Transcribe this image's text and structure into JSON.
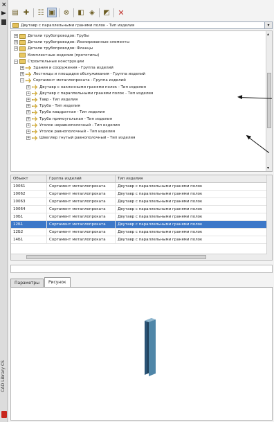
{
  "palette": {
    "title": "CAD Library CS"
  },
  "toolbar": {
    "buttons": [
      "folder-icon",
      "add-icon",
      "tree-view-icon",
      "list-view-icon",
      "binoculars-icon",
      "export-icon",
      "filter-icon",
      "properties-icon",
      "delete-icon"
    ]
  },
  "path": {
    "value": "Двутавр с параллельными гранями полок - Тип изделия"
  },
  "tree": {
    "rows": [
      {
        "label": "Детали трубопроводов: Трубы",
        "expander": "+",
        "level": 1,
        "kind": "folder"
      },
      {
        "label": "Детали трубопроводов: Изолированные элементы",
        "expander": "+",
        "level": 1,
        "kind": "folder"
      },
      {
        "label": "Детали трубопроводов: Фланцы",
        "expander": "+",
        "level": 1,
        "kind": "folder"
      },
      {
        "label": "Комплектные изделия (прототипы)",
        "expander": "",
        "level": 1,
        "kind": "folder"
      },
      {
        "label": "Строительные конструкции",
        "expander": "−",
        "level": 1,
        "kind": "folder"
      },
      {
        "label": "Здания и сооружения - Группа изделий",
        "expander": "+",
        "level": 2,
        "kind": "item"
      },
      {
        "label": "Лестницы и площадки обслуживания - Группа изделий",
        "expander": "+",
        "level": 2,
        "kind": "item"
      },
      {
        "label": "Сортамент металлопроката - Группа изделий",
        "expander": "−",
        "level": 2,
        "kind": "item"
      },
      {
        "label": "Двутавр с наклонными гранями полок - Тип изделия",
        "expander": "+",
        "level": 3,
        "kind": "item"
      },
      {
        "label": "Двутавр с параллельными гранями полок - Тип изделия",
        "expander": "+",
        "level": 3,
        "kind": "item"
      },
      {
        "label": "Тавр - Тип изделия",
        "expander": "+",
        "level": 3,
        "kind": "item"
      },
      {
        "label": "Труба - Тип изделия",
        "expander": "+",
        "level": 3,
        "kind": "item"
      },
      {
        "label": "Труба квадратная - Тип изделия",
        "expander": "+",
        "level": 3,
        "kind": "item"
      },
      {
        "label": "Труба прямоугольная - Тип изделия",
        "expander": "+",
        "level": 3,
        "kind": "item"
      },
      {
        "label": "Уголок неравнополочный - Тип изделия",
        "expander": "+",
        "level": 3,
        "kind": "item"
      },
      {
        "label": "Уголок равнополочный - Тип изделия",
        "expander": "+",
        "level": 3,
        "kind": "item"
      },
      {
        "label": "Швеллер гнутый равнополочный - Тип изделия",
        "expander": "+",
        "level": 3,
        "kind": "item"
      }
    ]
  },
  "table": {
    "headers": [
      "Объект",
      "Группа изделий",
      "Тип изделия"
    ],
    "rows": [
      [
        "10061",
        "Сортамент металлопроката",
        "Двутавр с параллельными гранями полок"
      ],
      [
        "10062",
        "Сортамент металлопроката",
        "Двутавр с параллельными гранями полок"
      ],
      [
        "10063",
        "Сортамент металлопроката",
        "Двутавр с параллельными гранями полок"
      ],
      [
        "10064",
        "Сортамент металлопроката",
        "Двутавр с параллельными гранями полок"
      ],
      [
        "10Б1",
        "Сортамент металлопроката",
        "Двутавр с параллельными гранями полок"
      ],
      [
        "12Б1",
        "Сортамент металлопроката",
        "Двутавр с параллельными гранями полок"
      ],
      [
        "12Б2",
        "Сортамент металлопроката",
        "Двутавр с параллельными гранями полок"
      ],
      [
        "14Б1",
        "Сортамент металлопроката",
        "Двутавр с параллельными гранями полок"
      ]
    ],
    "selected_row": 5
  },
  "tabs": [
    {
      "label": "Параметры",
      "active": false
    },
    {
      "label": "Рисунок",
      "active": true
    }
  ],
  "colors": {
    "selection": "#3d78c8",
    "beam_dark": "#1e3f5a",
    "beam_light": "#4f86a8"
  }
}
